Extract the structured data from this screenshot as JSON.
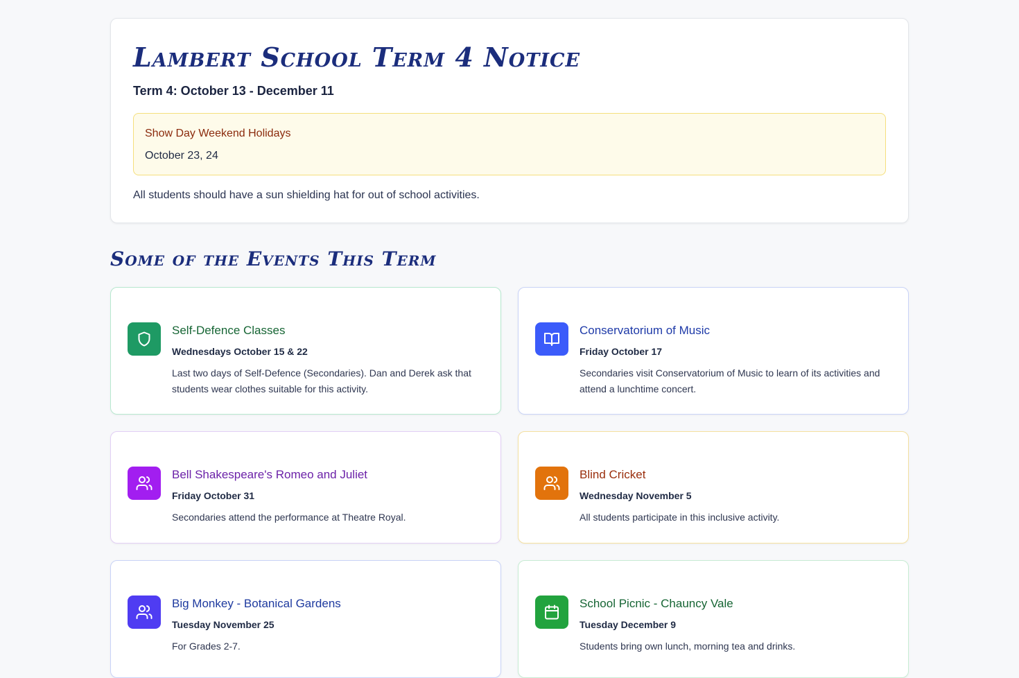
{
  "notice": {
    "title": "Lambert School Term 4 Notice",
    "term_dates": "Term 4: October 13 - December 11",
    "holiday": {
      "title": "Show Day Weekend Holidays",
      "dates": "October 23, 24"
    },
    "note": "All students should have a sun shielding hat for out of school activities."
  },
  "events_heading": "Some of the Events This Term",
  "events": [
    {
      "title": "Self-Defence Classes",
      "date": "Wednesdays October 15 & 22",
      "description": "Last two days of Self-Defence (Secondaries). Dan and Derek ask that students wear clothes suitable for this activity.",
      "icon": "shield-icon",
      "accent": "#1e9a64",
      "title_color": "#166534",
      "border": "#b7e8cf"
    },
    {
      "title": "Conservatorium of Music",
      "date": "Friday October 17",
      "description": "Secondaries visit Conservatorium of Music to learn of its activities and attend a lunchtime concert.",
      "icon": "book-icon",
      "accent": "#3b5bfa",
      "title_color": "#1e3aa8",
      "border": "#c9d3f7"
    },
    {
      "title": "Bell Shakespeare's Romeo and Juliet",
      "date": "Friday October 31",
      "description": "Secondaries attend the performance at Theatre Royal.",
      "icon": "users-icon",
      "accent": "#a21ef0",
      "title_color": "#6b21a8",
      "border": "#e2cff5"
    },
    {
      "title": "Blind Cricket",
      "date": "Wednesday November 5",
      "description": "All students participate in this inclusive activity.",
      "icon": "users-icon",
      "accent": "#e2730c",
      "title_color": "#9a2e0c",
      "border": "#f4e0a0"
    },
    {
      "title": "Big Monkey - Botanical Gardens",
      "date": "Tuesday November 25",
      "description": "For Grades 2-7.",
      "icon": "users-icon",
      "accent": "#4f3cf2",
      "title_color": "#1e3a9f",
      "border": "#c9d3f7"
    },
    {
      "title": "School Picnic - Chauncy Vale",
      "date": "Tuesday December 9",
      "description": "Students bring own lunch, morning tea and drinks.",
      "icon": "calendar-icon",
      "accent": "#22a33e",
      "title_color": "#166534",
      "border": "#c7ecd3"
    }
  ]
}
